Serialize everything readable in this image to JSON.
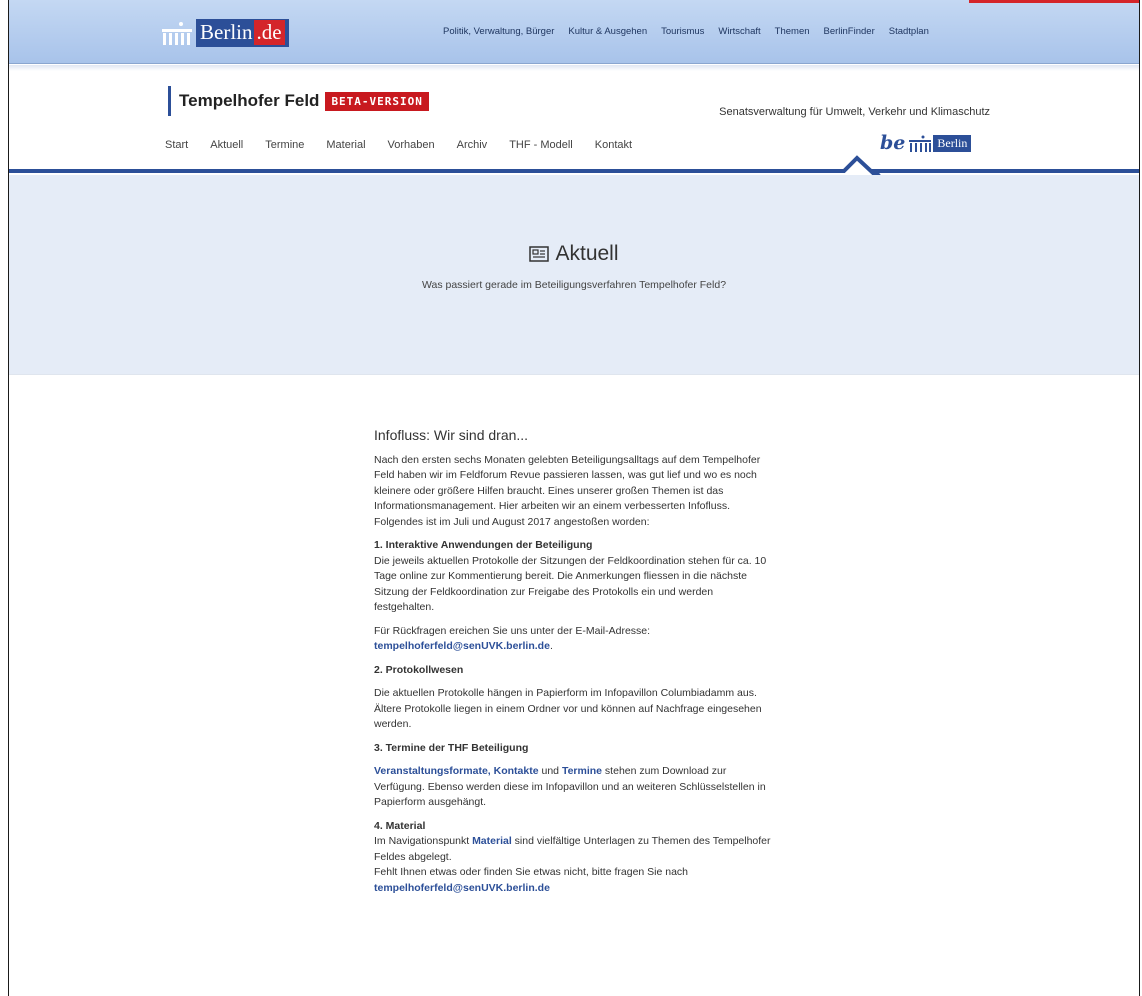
{
  "portal": {
    "logo_main": "Berlin",
    "logo_dot_de": ".de",
    "nav": [
      "Politik, Verwaltung, Bürger",
      "Kultur & Ausgehen",
      "Tourismus",
      "Wirtschaft",
      "Themen",
      "BerlinFinder",
      "Stadtplan"
    ],
    "colors": {
      "bar": "#b5cdee",
      "accent_red": "#d4252a",
      "brand_blue": "#2c4f98"
    }
  },
  "site": {
    "title": "Tempelhofer Feld",
    "badge": "BETA-VERSION",
    "department": "Senatsverwaltung für Umwelt, Verkehr und Klimaschutz",
    "nav": [
      "Start",
      "Aktuell",
      "Termine",
      "Material",
      "Vorhaben",
      "Archiv",
      "THF - Modell",
      "Kontakt"
    ],
    "be_berlin": {
      "be": "be",
      "berlin": "Berlin"
    }
  },
  "hero": {
    "icon": "newspaper-icon",
    "title": "Aktuell",
    "subtitle": "Was passiert gerade im Beteiligungsverfahren Tempelhofer Feld?"
  },
  "article": {
    "title": "Infofluss: Wir sind dran...",
    "intro": "Nach den ersten sechs Monaten gelebten Beteiligungsalltags auf dem Tempelhofer Feld haben wir im Feldforum Revue passieren lassen, was gut lief und wo es noch kleinere oder größere Hilfen braucht. Eines unserer großen Themen ist das Informationsmanagement. Hier arbeiten wir an einem verbesserten Infofluss. Folgendes ist im Juli und August 2017 angestoßen worden:",
    "s1_heading": "1. Interaktive Anwendungen der Beteiligung",
    "s1_text": "Die jeweils aktuellen Protokolle der Sitzungen der Feldkoordination stehen für ca. 10 Tage online zur Kommentierung bereit. Die Anmerkungen fliessen in die nächste Sitzung der Feldkoordination zur Freigabe des Protokolls ein und werden festgehalten.",
    "s1_contact_text": "Für Rückfragen ereichen Sie uns unter der E-Mail-Adresse:",
    "email": "tempelhoferfeld@senUVK.berlin.de",
    "s2_heading": "2. Protokollwesen",
    "s2_text": "Die aktuellen Protokolle hängen in Papierform im Infopavillon Columbiadamm aus. Ältere Protokolle liegen in einem Ordner vor und können auf Nachfrage eingesehen werden.",
    "s3_heading": "3. Termine der THF Beteiligung",
    "s3_link1": "Veranstaltungsformate",
    "s3_comma": ", ",
    "s3_link2": "Kontakte",
    "s3_and": " und ",
    "s3_link3": "Termine",
    "s3_text": " stehen zum Download zur Verfügung. Ebenso werden diese im Infopavillon und an weiteren Schlüsselstellen in Papierform ausgehängt.",
    "s4_heading": "4. Material",
    "s4_pre": "Im Navigationspunkt ",
    "s4_link": "Material",
    "s4_text": " sind vielfältige Unterlagen zu Themen des Tempelhofer Feldes abgelegt.",
    "s4_text2": "Fehlt Ihnen etwas oder finden Sie etwas nicht, bitte fragen Sie nach"
  }
}
